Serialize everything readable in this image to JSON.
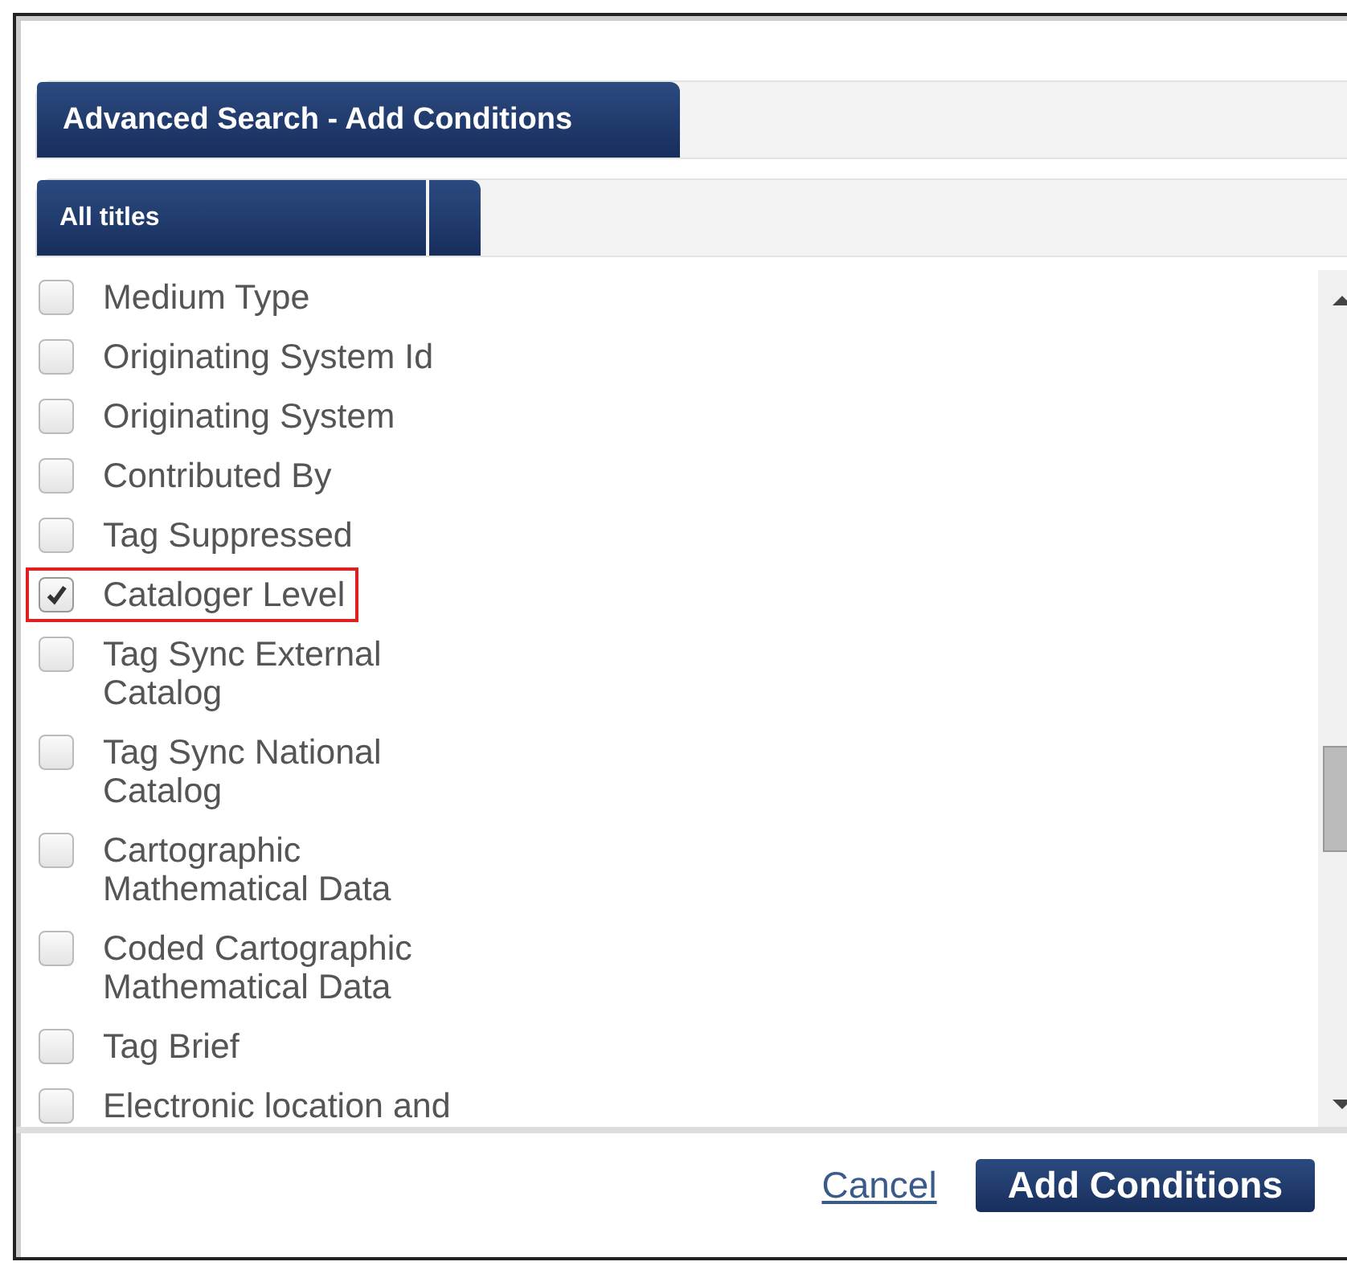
{
  "dialog": {
    "title": "Advanced Search - Add Conditions",
    "subtab": "All titles"
  },
  "fields": [
    {
      "label": "Medium Type",
      "checked": false,
      "highlighted": false
    },
    {
      "label": "Originating System Id",
      "checked": false,
      "highlighted": false
    },
    {
      "label": "Originating System",
      "checked": false,
      "highlighted": false
    },
    {
      "label": "Contributed By",
      "checked": false,
      "highlighted": false
    },
    {
      "label": "Tag Suppressed",
      "checked": false,
      "highlighted": false
    },
    {
      "label": "Cataloger Level",
      "checked": true,
      "highlighted": true
    },
    {
      "label": "Tag Sync External Catalog",
      "checked": false,
      "highlighted": false
    },
    {
      "label": "Tag Sync National Catalog",
      "checked": false,
      "highlighted": false
    },
    {
      "label": "Cartographic Mathematical Data",
      "checked": false,
      "highlighted": false
    },
    {
      "label": "Coded Cartographic Mathematical Data",
      "checked": false,
      "highlighted": false
    },
    {
      "label": "Tag Brief",
      "checked": false,
      "highlighted": false
    },
    {
      "label": "Electronic location and",
      "checked": false,
      "highlighted": false
    }
  ],
  "buttons": {
    "cancel": "Cancel",
    "submit": "Add Conditions"
  }
}
